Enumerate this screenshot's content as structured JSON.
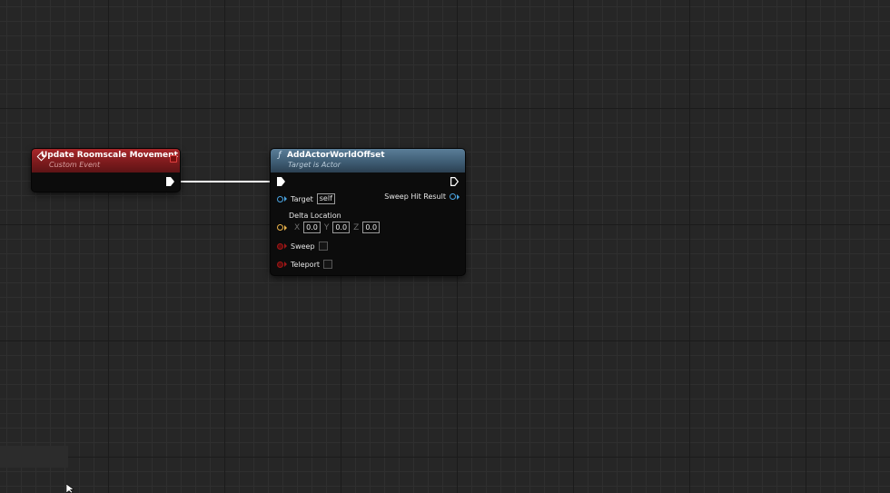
{
  "nodes": {
    "custom_event": {
      "title": "Update Roomscale Movement",
      "subtitle": "Custom Event",
      "header_color": "#8e1f21"
    },
    "function_call": {
      "title": "AddActorWorldOffset",
      "subtitle": "Target is Actor",
      "header_color": "#4a6b84",
      "pins": {
        "target_label": "Target",
        "target_value": "self",
        "sweep_hit_result_label": "Sweep Hit Result",
        "delta_location_label": "Delta Location",
        "x_label": "X",
        "x_value": "0.0",
        "y_label": "Y",
        "y_value": "0.0",
        "z_label": "Z",
        "z_value": "0.0",
        "sweep_label": "Sweep",
        "teleport_label": "Teleport"
      }
    }
  },
  "colors": {
    "exec_wire": "#ffffff",
    "object_pin": "#4aa3e0",
    "vector_pin": "#e9b24a",
    "bool_pin": "#a01818",
    "grid_background": "#262626"
  },
  "icons": {
    "event_icon": "diamond-event-icon",
    "function_icon": "function-f-icon",
    "cursor": "mouse-pointer-icon"
  }
}
